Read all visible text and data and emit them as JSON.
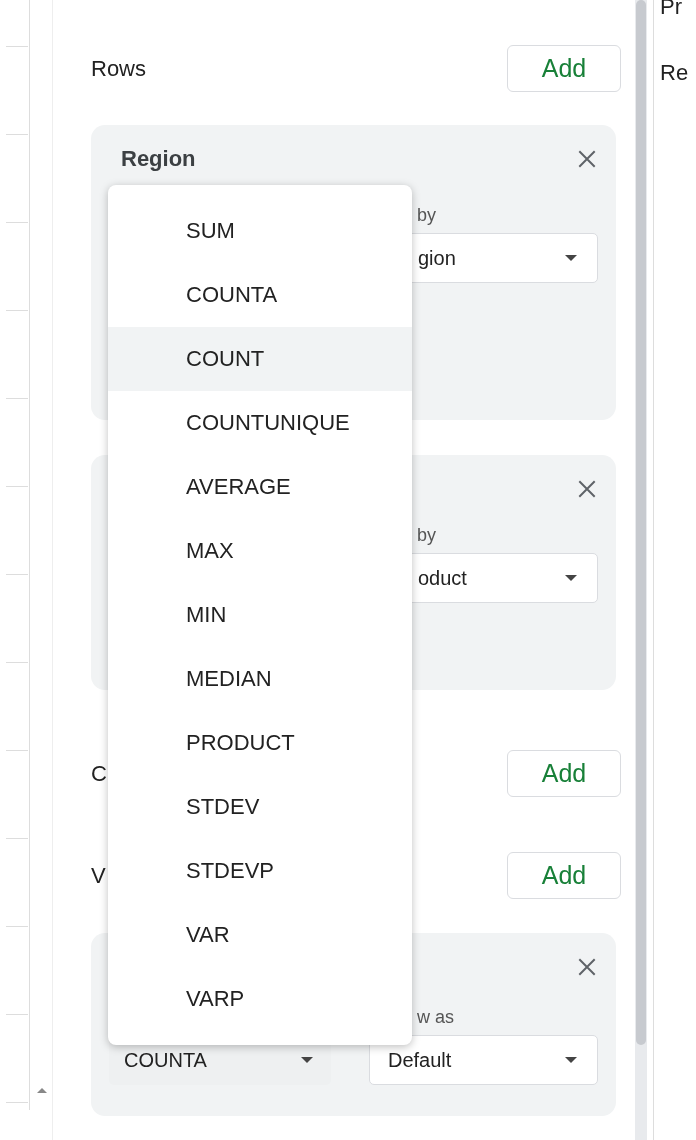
{
  "rows_section": {
    "title": "Rows",
    "add_button": "Add",
    "cards": [
      {
        "title": "Region",
        "label": "by",
        "select": "gion"
      },
      {
        "label": "by",
        "select": "oduct"
      }
    ]
  },
  "columns_section": {
    "title": "C",
    "add_button": "Add"
  },
  "values_section": {
    "title": "V",
    "add_button": "Add",
    "card": {
      "summarize": "COUNTA",
      "label": "w as",
      "select": "Default"
    }
  },
  "summarize_menu": [
    {
      "label": "SUM",
      "selected": false
    },
    {
      "label": "COUNTA",
      "selected": false
    },
    {
      "label": "COUNT",
      "selected": true
    },
    {
      "label": "COUNTUNIQUE",
      "selected": false
    },
    {
      "label": "AVERAGE",
      "selected": false
    },
    {
      "label": "MAX",
      "selected": false
    },
    {
      "label": "MIN",
      "selected": false
    },
    {
      "label": "MEDIAN",
      "selected": false
    },
    {
      "label": "PRODUCT",
      "selected": false
    },
    {
      "label": "STDEV",
      "selected": false
    },
    {
      "label": "STDEVP",
      "selected": false
    },
    {
      "label": "VAR",
      "selected": false
    },
    {
      "label": "VARP",
      "selected": false
    }
  ],
  "side_texts": [
    "Pr",
    "Re"
  ]
}
